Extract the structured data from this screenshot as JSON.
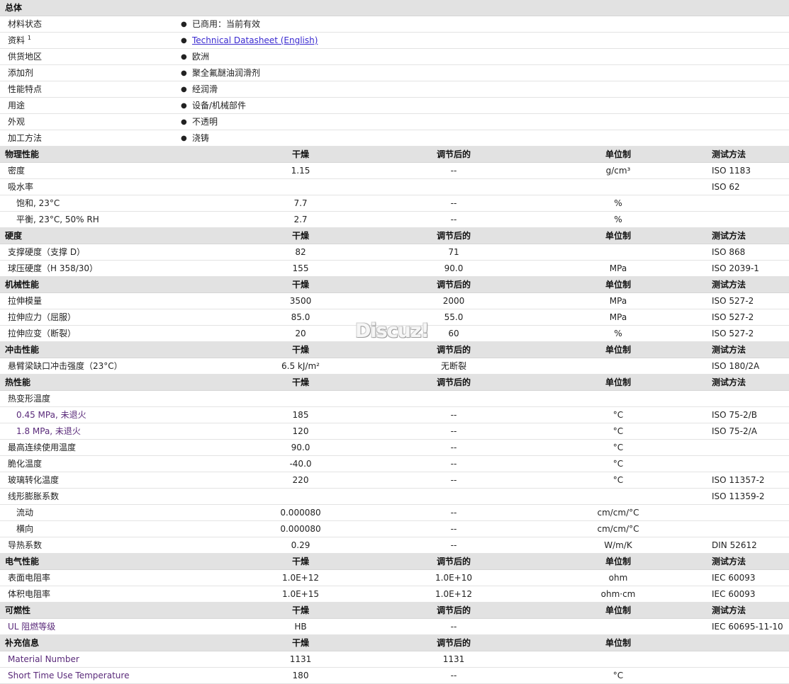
{
  "general": {
    "title": "总体",
    "rows": [
      {
        "label": "材料状态",
        "value": "已商用：当前有效"
      },
      {
        "label": "资料",
        "sup": "1",
        "value": "Technical Datasheet (English)",
        "link": true
      },
      {
        "label": "供货地区",
        "value": "欧洲"
      },
      {
        "label": "添加剂",
        "value": "聚全氟醚油润滑剂"
      },
      {
        "label": "性能特点",
        "value": "经润滑"
      },
      {
        "label": "用途",
        "value": "设备/机械部件"
      },
      {
        "label": "外观",
        "value": "不透明"
      },
      {
        "label": "加工方法",
        "value": "浇铸"
      }
    ]
  },
  "sections": [
    {
      "id": "physical",
      "title": "物理性能",
      "col_dry": "干燥",
      "col_cond": "调节后的",
      "col_unit": "单位制",
      "col_test": "测试方法",
      "rows": [
        {
          "name": "密度",
          "dry": "1.15",
          "cond": "--",
          "unit": "g/cm³",
          "test": "ISO 1183"
        },
        {
          "name": "吸水率",
          "dry": "",
          "cond": "",
          "unit": "",
          "test": "ISO 62"
        },
        {
          "name": "饱和, 23°C",
          "indent": 1,
          "dry": "7.7",
          "cond": "--",
          "unit": "%",
          "test": ""
        },
        {
          "name": "平衡, 23°C, 50% RH",
          "indent": 1,
          "dry": "2.7",
          "cond": "--",
          "unit": "%",
          "test": ""
        }
      ]
    },
    {
      "id": "hardness",
      "title": "硬度",
      "col_dry": "干燥",
      "col_cond": "调节后的",
      "col_unit": "单位制",
      "col_test": "测试方法",
      "rows": [
        {
          "name": "支撑硬度（支撑 D）",
          "dry": "82",
          "cond": "71",
          "unit": "",
          "test": "ISO 868"
        },
        {
          "name": "球压硬度（H 358/30）",
          "dry": "155",
          "cond": "90.0",
          "unit": "MPa",
          "test": "ISO 2039-1"
        }
      ]
    },
    {
      "id": "mechanical",
      "title": "机械性能",
      "col_dry": "干燥",
      "col_cond": "调节后的",
      "col_unit": "单位制",
      "col_test": "测试方法",
      "rows": [
        {
          "name": "拉伸模量",
          "dry": "3500",
          "cond": "2000",
          "unit": "MPa",
          "test": "ISO 527-2"
        },
        {
          "name": "拉伸应力（屈服）",
          "dry": "85.0",
          "cond": "55.0",
          "unit": "MPa",
          "test": "ISO 527-2"
        },
        {
          "name": "拉伸应变（断裂）",
          "dry": "20",
          "cond": "60",
          "unit": "%",
          "test": "ISO 527-2"
        }
      ]
    },
    {
      "id": "impact",
      "title": "冲击性能",
      "col_dry": "干燥",
      "col_cond": "调节后的",
      "col_unit": "单位制",
      "col_test": "测试方法",
      "rows": [
        {
          "name": "悬臂梁缺口冲击强度（23°C）",
          "dry": "6.5 kJ/m²",
          "cond": "无断裂",
          "unit": "",
          "test": "ISO 180/2A"
        }
      ]
    },
    {
      "id": "thermal",
      "title": "热性能",
      "col_dry": "干燥",
      "col_cond": "调节后的",
      "col_unit": "单位制",
      "col_test": "测试方法",
      "rows": [
        {
          "name": "热变形温度",
          "dry": "",
          "cond": "",
          "unit": "",
          "test": ""
        },
        {
          "name": "0.45 MPa, 未退火",
          "indent": 1,
          "purple": true,
          "dry": "185",
          "cond": "--",
          "unit": "°C",
          "test": "ISO 75-2/B"
        },
        {
          "name": "1.8 MPa, 未退火",
          "indent": 1,
          "purple": true,
          "dry": "120",
          "cond": "--",
          "unit": "°C",
          "test": "ISO 75-2/A"
        },
        {
          "name": "最高连续使用温度",
          "dry": "90.0",
          "cond": "--",
          "unit": "°C",
          "test": ""
        },
        {
          "name": "脆化温度",
          "dry": "-40.0",
          "cond": "--",
          "unit": "°C",
          "test": ""
        },
        {
          "name": "玻璃转化温度",
          "dry": "220",
          "cond": "--",
          "unit": "°C",
          "test": "ISO 11357-2"
        },
        {
          "name": "线形膨胀系数",
          "dry": "",
          "cond": "",
          "unit": "",
          "test": "ISO 11359-2"
        },
        {
          "name": "流动",
          "indent": 1,
          "dry": "0.000080",
          "cond": "--",
          "unit": "cm/cm/°C",
          "test": ""
        },
        {
          "name": "横向",
          "indent": 1,
          "dry": "0.000080",
          "cond": "--",
          "unit": "cm/cm/°C",
          "test": ""
        },
        {
          "name": "导热系数",
          "dry": "0.29",
          "cond": "--",
          "unit": "W/m/K",
          "test": "DIN 52612"
        }
      ]
    },
    {
      "id": "electrical",
      "title": "电气性能",
      "col_dry": "干燥",
      "col_cond": "调节后的",
      "col_unit": "单位制",
      "col_test": "测试方法",
      "rows": [
        {
          "name": "表面电阻率",
          "dry": "1.0E+12",
          "cond": "1.0E+10",
          "unit": "ohm",
          "test": "IEC 60093"
        },
        {
          "name": "体积电阻率",
          "dry": "1.0E+15",
          "cond": "1.0E+12",
          "unit": "ohm·cm",
          "test": "IEC 60093"
        }
      ]
    },
    {
      "id": "flammability",
      "title": "可燃性",
      "col_dry": "干燥",
      "col_cond": "调节后的",
      "col_unit": "单位制",
      "col_test": "测试方法",
      "rows": [
        {
          "name": "UL 阻燃等级",
          "purple": true,
          "dry": "HB",
          "cond": "--",
          "unit": "",
          "test": "IEC 60695-11-10"
        }
      ]
    },
    {
      "id": "supplemental",
      "title": "补充信息",
      "col_dry": "干燥",
      "col_cond": "调节后的",
      "col_unit": "单位制",
      "col_test": "",
      "rows": [
        {
          "name": "Material Number",
          "purple": true,
          "dry": "1131",
          "cond": "1131",
          "unit": "",
          "test": ""
        },
        {
          "name": "Short Time Use Temperature",
          "purple": true,
          "dry": "180",
          "cond": "--",
          "unit": "°C",
          "test": ""
        }
      ]
    }
  ],
  "watermark": "Discuz!"
}
